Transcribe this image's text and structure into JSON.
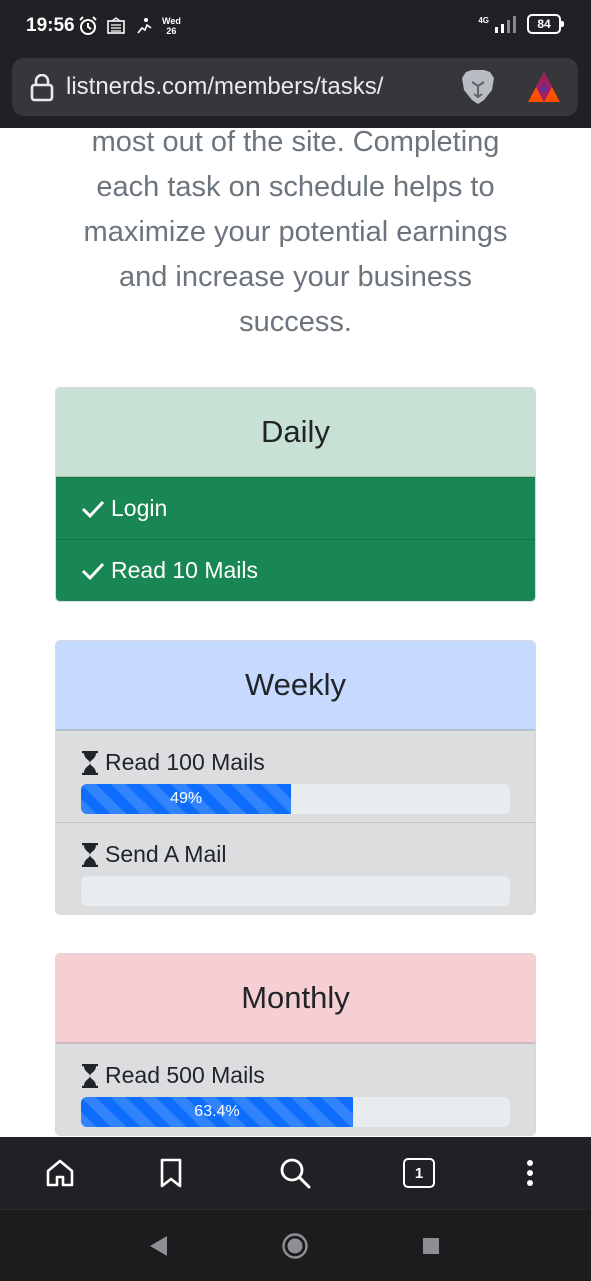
{
  "status_bar": {
    "time": "19:56",
    "day_name": "Wed",
    "day_num": "26",
    "network": "4G",
    "battery": "84"
  },
  "browser": {
    "url": "listnerds.com/members/tasks/",
    "tab_count": "1"
  },
  "intro_text": "most out of the site. Completing each task on schedule helps to maximize your potential earnings and increase your business success.",
  "daily": {
    "title": "Daily",
    "items": [
      {
        "label": "Login"
      },
      {
        "label": "Read 10 Mails"
      }
    ]
  },
  "weekly": {
    "title": "Weekly",
    "items": [
      {
        "label": "Read 100 Mails",
        "progress_label": "49%",
        "progress": 49
      },
      {
        "label": "Send A Mail",
        "progress_label": "",
        "progress": 0
      }
    ]
  },
  "monthly": {
    "title": "Monthly",
    "items": [
      {
        "label": "Read 500 Mails",
        "progress_label": "63.4%",
        "progress": 63.4
      }
    ]
  },
  "colors": {
    "daily_header": "#c7e2d4",
    "weekly_header": "#c5dafe",
    "monthly_header": "#f5cfd2",
    "success": "#198754",
    "progress": "#0d6efd"
  },
  "icons": [
    "lock-icon",
    "brave-lion-icon",
    "bat-triangle-icon",
    "check-icon",
    "hourglass-icon",
    "home-icon",
    "bookmark-icon",
    "search-icon",
    "tabs-icon",
    "more-vertical-icon",
    "back-icon",
    "home-circle-icon",
    "recents-square-icon"
  ]
}
